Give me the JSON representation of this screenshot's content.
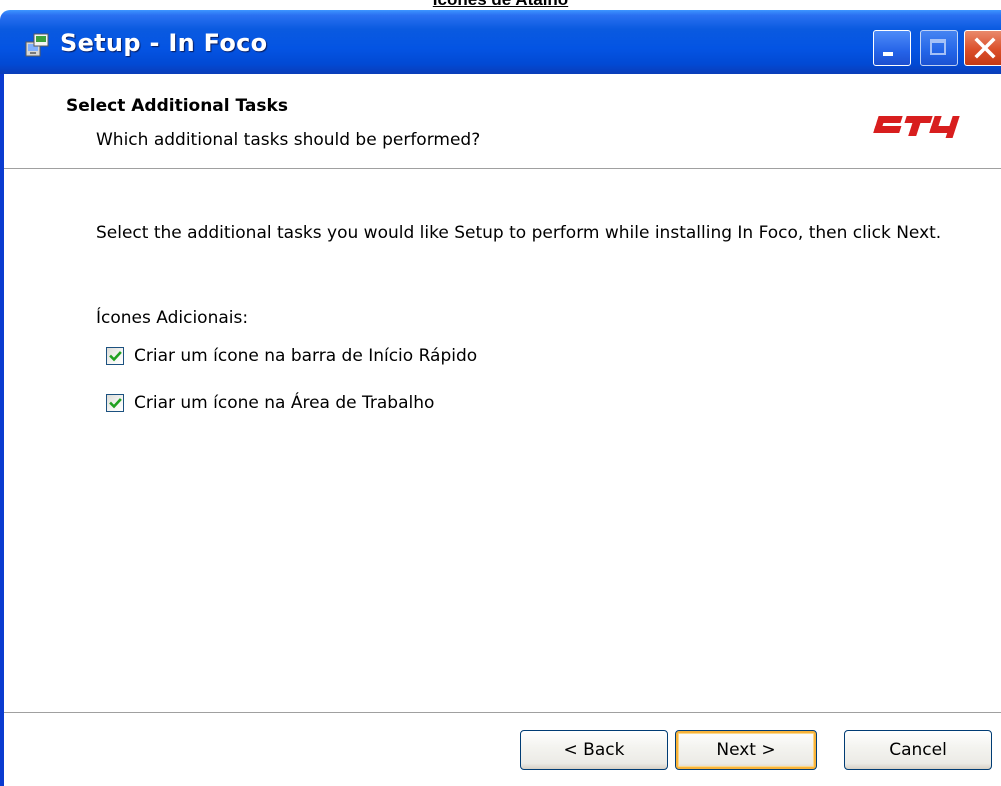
{
  "document": {
    "heading": "Ícones de Atalho"
  },
  "window": {
    "title": "Setup - In Foco",
    "controls": {
      "minimize": "minimize-icon",
      "maximize": "maximize-icon",
      "close": "close-icon"
    }
  },
  "header": {
    "title": "Select Additional Tasks",
    "subtitle": "Which additional tasks should be performed?",
    "logo_text": "lsTy"
  },
  "body": {
    "intro": "Select the additional tasks you would like Setup to perform while installing In Foco, then click Next.",
    "group_label": "Ícones Adicionais:",
    "tasks": [
      {
        "label": "Criar um ícone na barra de Início Rápido",
        "checked": true
      },
      {
        "label": "Criar um ícone na Área de Trabalho",
        "checked": true
      }
    ]
  },
  "buttons": {
    "back": "< Back",
    "next": "Next >",
    "cancel": "Cancel"
  },
  "colors": {
    "title_bar": "#0454e3",
    "close_button": "#db4f2a",
    "logo": "#d81e1e",
    "default_button_highlight": "#f8b33a",
    "checkmark": "#21a121"
  }
}
